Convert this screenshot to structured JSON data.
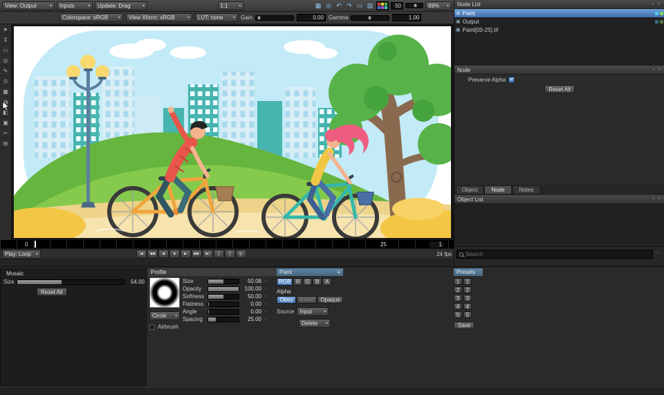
{
  "toolbar": {
    "view": "View: Output",
    "inputs": "Inputs",
    "update": "Update: Drag",
    "ratio": "1:1",
    "brush_size": "50",
    "zoom": "69%"
  },
  "viewer": {
    "colorspace": "Colorspace: sRGB",
    "view_xform": "View Xform: sRGB",
    "lut": "LUT: none",
    "gain_label": "Gain",
    "gain_value": "0.00",
    "gamma_label": "Gamma",
    "gamma_value": "1.00"
  },
  "node_list": {
    "title": "Node List",
    "nodes": [
      {
        "label": "Paint"
      },
      {
        "label": "Output"
      },
      {
        "label": "Paint[00-25].tif"
      }
    ]
  },
  "node_panel": {
    "title": "Node",
    "preserve_alpha": "Preserve Alpha",
    "reset_all": "Reset All"
  },
  "tabs": {
    "object": "Object",
    "node": "Node",
    "notes": "Notes"
  },
  "object_list": {
    "title": "Object List",
    "search_placeholder": "Search"
  },
  "timeline": {
    "frame_start": "0",
    "frame_end": "25",
    "current_frame": "1",
    "play_mode": "Play: Loop",
    "fps": "24 fps"
  },
  "mosaic": {
    "title": "Mosaic",
    "size_label": "Size",
    "size_value": "54.00",
    "reset_all": "Reset All"
  },
  "profile": {
    "title": "Profile",
    "params": [
      {
        "label": "Size",
        "value": "50.08"
      },
      {
        "label": "Opacity",
        "value": "100.00"
      },
      {
        "label": "Softness",
        "value": "50.00"
      },
      {
        "label": "Flatness",
        "value": "0.00"
      },
      {
        "label": "Angle",
        "value": "0.00"
      },
      {
        "label": "Spacing",
        "value": "25.00"
      }
    ],
    "shape": "Circle",
    "airbrush": "Airbrush"
  },
  "paint": {
    "title": "Paint",
    "channels": [
      "RGB",
      "R",
      "G",
      "B",
      "A"
    ],
    "alpha_label": "Alpha",
    "obey": "Obey",
    "invert": "Invert",
    "opaque": "Opaque",
    "source_label": "Source",
    "source_value": "Input",
    "delete_label": "Delete"
  },
  "presets": {
    "title": "Presets",
    "slots": [
      "1",
      "2",
      "3",
      "4",
      "5"
    ],
    "save": "Save"
  },
  "icons": {
    "arrow": "▾",
    "check": "✓",
    "pin": "▪",
    "close": "×",
    "menu": "≡",
    "lock": "▫",
    "node_icon": "▣",
    "top": [
      "▦",
      "◎",
      "↶",
      "↷",
      "▭",
      "▤"
    ],
    "transport": [
      "|◀",
      "◀◀",
      "◀",
      "■",
      "▶",
      "▶▶",
      "▶|",
      "[",
      "]",
      "↻"
    ],
    "tools": [
      "➤",
      "⇕",
      "▭",
      "◎",
      "✎",
      "⊙",
      "▦",
      "▤",
      "◧",
      "▣",
      "✂",
      "⊞"
    ]
  },
  "colors": {
    "selection_blue": "#4f7fbe",
    "panel_header_blue": "#4e7191",
    "indicator_cyan": "#54c8e8",
    "indicator_green": "#7ed651"
  }
}
